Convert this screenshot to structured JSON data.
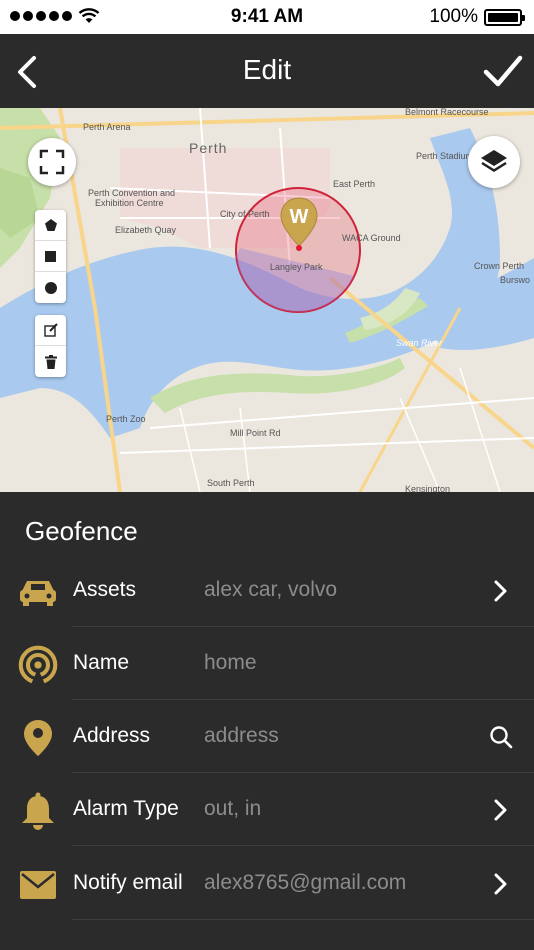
{
  "status_bar": {
    "time": "9:41 AM",
    "battery": "100%"
  },
  "nav": {
    "title": "Edit",
    "back_icon": "chevron-left-icon",
    "done_icon": "checkmark-icon"
  },
  "map": {
    "labels": {
      "perth": "Perth",
      "perth_arena": "Perth Arena",
      "perth_convention": "Perth Convention and",
      "exhibition_centre": "Exhibition Centre",
      "elizabeth_quay": "Elizabeth Quay",
      "city_of_perth": "City of Perth",
      "east_perth": "East Perth",
      "waca_ground": "WACA Ground",
      "langley_park": "Langley Park",
      "perth_stadium": "Perth Stadium",
      "burswood": "Burswo",
      "crown_perth": "Crown Perth",
      "swan_river": "Swan River",
      "perth_zoo": "Perth Zoo",
      "south_perth": "South Perth",
      "kensington": "Kensington",
      "mill_point": "Mill Point Rd",
      "belmont": "Belmont Racecourse"
    },
    "geofence_marker": "W",
    "colors": {
      "circle_stroke": "#d0223a",
      "circle_fill": "rgba(230,80,100,0.28)",
      "marker": "#c9a54e"
    }
  },
  "geofence": {
    "title": "Geofence",
    "accent_color": "#c9a54e",
    "rows": [
      {
        "icon": "car-icon",
        "label": "Assets",
        "value": "alex car, volvo",
        "action": "chevron-right-icon"
      },
      {
        "icon": "signal-icon",
        "label": "Name",
        "value": "home",
        "action": ""
      },
      {
        "icon": "location-pin-icon",
        "label": "Address",
        "value": "address",
        "action": "search-icon"
      },
      {
        "icon": "bell-icon",
        "label": "Alarm Type",
        "value": "out, in",
        "action": "chevron-right-icon"
      },
      {
        "icon": "envelope-icon",
        "label": "Notify email",
        "value": "alex8765@gmail.com",
        "action": "chevron-right-icon"
      }
    ]
  }
}
